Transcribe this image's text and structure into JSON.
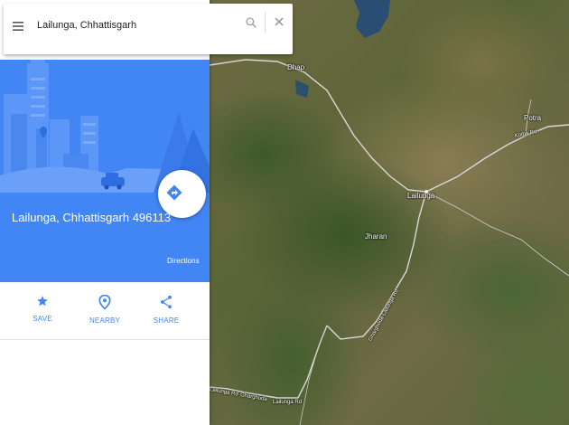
{
  "search": {
    "value": "Lailunga, Chhattisgarh"
  },
  "place": {
    "title": "Lailunga, Chhattisgarh 496113"
  },
  "directions": {
    "label": "Directions"
  },
  "actions": [
    {
      "label": "SAVE",
      "icon": "star-icon"
    },
    {
      "label": "NEARBY",
      "icon": "pin-icon"
    },
    {
      "label": "SHARE",
      "icon": "share-icon"
    }
  ],
  "map": {
    "labels": {
      "dhap": "Dhap",
      "potra": "Potra",
      "kotba_rd": "Kotba Rd",
      "lailunga": "Lailunga",
      "jharan": "Jharan"
    },
    "roads": {
      "gharghoda_road": "Gharghoda-Lailunga Rd",
      "lailunga_rd": "Lailunga Rd",
      "gharghoda": "Gharghoda",
      "lailunga_rd_2": "Lailunga Rd"
    }
  },
  "colors": {
    "accent": "#4285f4",
    "panel_bg": "#ffffff"
  }
}
